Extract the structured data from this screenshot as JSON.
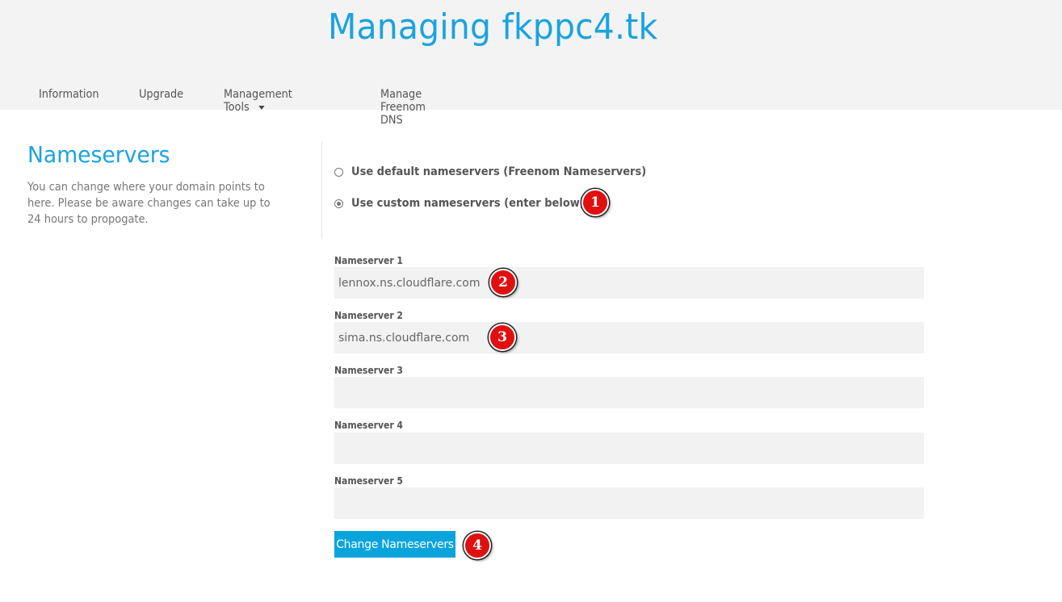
{
  "header": {
    "title": "Managing fkppc4.tk",
    "nav": [
      {
        "label": "Information"
      },
      {
        "label": "Upgrade"
      },
      {
        "label": "Management Tools",
        "has_dropdown": true
      },
      {
        "label": "Manage Freenom DNS"
      }
    ]
  },
  "section": {
    "title": "Nameservers",
    "description": "You can change where your domain points to here. Please be aware changes can take up to 24 hours to propogate."
  },
  "options": {
    "default_label": "Use default nameservers (Freenom Nameservers)",
    "custom_label": "Use custom nameservers (enter below)",
    "selected": "custom"
  },
  "fields": [
    {
      "label": "Nameserver 1",
      "value": "lennox.ns.cloudflare.com"
    },
    {
      "label": "Nameserver 2",
      "value": "sima.ns.cloudflare.com"
    },
    {
      "label": "Nameserver 3",
      "value": ""
    },
    {
      "label": "Nameserver 4",
      "value": ""
    },
    {
      "label": "Nameserver 5",
      "value": ""
    }
  ],
  "submit_label": "Change Nameservers",
  "markers": [
    "1",
    "2",
    "3",
    "4"
  ],
  "colors": {
    "accent": "#1aa3e0",
    "button": "#0aa4dd",
    "marker": "#e01010"
  }
}
